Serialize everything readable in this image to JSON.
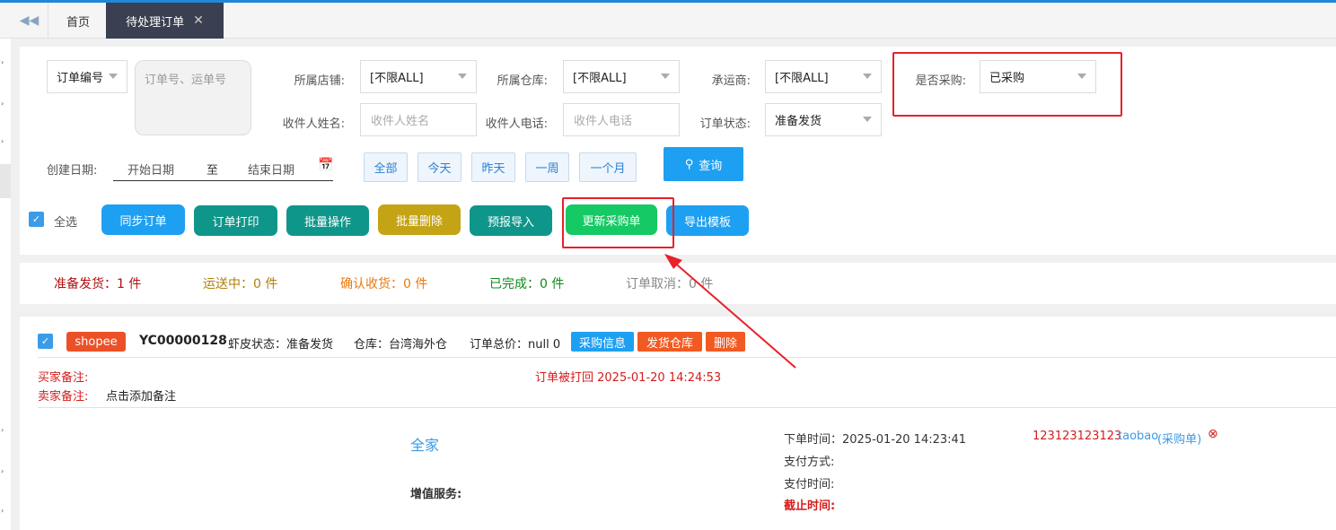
{
  "tabs": {
    "home": "首页",
    "active": "待处理订单",
    "close": "✕"
  },
  "filters": {
    "order_field": "订单编号",
    "order_input_placeholder": "订单号、运单号",
    "store_label": "所属店铺:",
    "store_value": "[不限ALL]",
    "warehouse_label": "所属仓库:",
    "warehouse_value": "[不限ALL]",
    "carrier_label": "承运商:",
    "carrier_value": "[不限ALL]",
    "purchased_label": "是否采购:",
    "purchased_value": "已采购",
    "receiver_name_label": "收件人姓名:",
    "receiver_name_placeholder": "收件人姓名",
    "receiver_phone_label": "收件人电话:",
    "receiver_phone_placeholder": "收件人电话",
    "order_status_label": "订单状态:",
    "order_status_value": "准备发货",
    "create_date_label": "创建日期:",
    "start_date_placeholder": "开始日期",
    "date_to": "至",
    "end_date_placeholder": "结束日期",
    "quick_dates": [
      "全部",
      "今天",
      "昨天",
      "一周",
      "一个月"
    ],
    "search_button": "查询"
  },
  "actions": {
    "select_all": "全选",
    "sync": "同步订单",
    "print": "订单打印",
    "batch_op": "批量操作",
    "batch_delete": "批量删除",
    "pre_import": "预报导入",
    "update_purchase": "更新采购单",
    "export_template": "导出模板"
  },
  "stats": {
    "ready": "准备发货：1 件",
    "shipping": "运送中：0 件",
    "confirm": "确认收货：0 件",
    "done": "已完成：0 件",
    "cancel": "订单取消：0 件"
  },
  "order": {
    "platform": "shopee",
    "id": "YC00000128",
    "shopee_status": "虾皮状态：准备发货",
    "warehouse": "仓库：台湾海外仓",
    "total": "订单总价：null 0",
    "btn_purchase_info": "采购信息",
    "btn_ship_warehouse": "发货仓库",
    "btn_delete": "删除",
    "buyer_note_label": "买家备注:",
    "seller_note_label": "卖家备注:",
    "seller_note_value": "点击添加备注",
    "printed_back": "订单被打回 2025-01-20 14:24:53",
    "store_name": "全家",
    "value_added": "增值服务:",
    "order_time": "下单时间：2025-01-20 14:23:41",
    "pay_method": "支付方式:",
    "pay_time": "支付时间:",
    "deadline": "截止时间:",
    "purchase_no": "123123123123",
    "purchase_src": "taobao",
    "purchase_tag": "(采购单)"
  },
  "colors": {
    "blue": "#1ea0f2",
    "teal": "#0f968a",
    "olive": "#c4a314",
    "green": "#15c964",
    "red_annotation": "#e8202a",
    "dark_tab": "#3a3f51"
  }
}
